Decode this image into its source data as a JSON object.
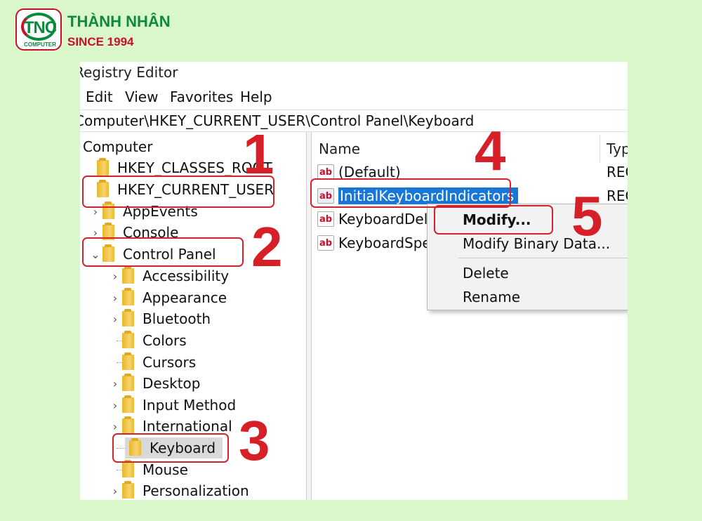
{
  "brand": {
    "logo_text": "TNC",
    "logo_sub": "COMPUTER",
    "name": "THÀNH NHÂN",
    "since": "SINCE 1994"
  },
  "window": {
    "title": "Registry Editor",
    "menu": [
      "Edit",
      "View",
      "Favorites",
      "Help"
    ],
    "address": "Computer\\HKEY_CURRENT_USER\\Control Panel\\Keyboard"
  },
  "tree": {
    "root": "Computer",
    "hives": [
      "HKEY_CLASSES_ROOT",
      "HKEY_CURRENT_USER"
    ],
    "hkcu_children": [
      "AppEvents",
      "Console",
      "Control Panel"
    ],
    "control_panel_children": [
      "Accessibility",
      "Appearance",
      "Bluetooth",
      "Colors",
      "Cursors",
      "Desktop",
      "Input Method",
      "International",
      "Keyboard",
      "Mouse",
      "Personalization"
    ],
    "selected": "Keyboard"
  },
  "list": {
    "columns": {
      "name": "Name",
      "type": "Type"
    },
    "rows": [
      {
        "icon": "ab",
        "name": "(Default)",
        "type": "REG_SZ"
      },
      {
        "icon": "ab",
        "name": "InitialKeyboardIndicators",
        "type": "REG_SZ"
      },
      {
        "icon": "ab",
        "name": "KeyboardDelay",
        "type": ""
      },
      {
        "icon": "ab",
        "name": "KeyboardSpeed",
        "type": ""
      }
    ]
  },
  "context_menu": [
    "Modify...",
    "Modify Binary Data...",
    "Delete",
    "Rename"
  ],
  "annotations": [
    "1",
    "2",
    "3",
    "4",
    "5"
  ],
  "colors": {
    "annotation": "#d61f26",
    "selection": "#1877d6",
    "background": "#d9f7c8",
    "brand_green": "#0b8a3a"
  }
}
